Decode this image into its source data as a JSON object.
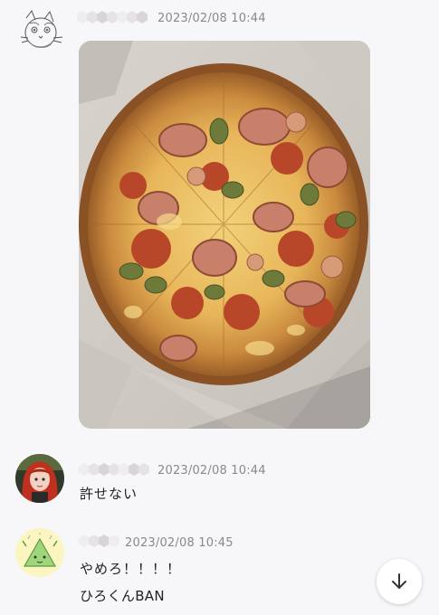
{
  "messages": [
    {
      "time": "2023/02/08 10:44",
      "avatar_icon": "cat-sketch-avatar",
      "attachment": "pizza-photo"
    },
    {
      "time": "2023/02/08 10:44",
      "avatar_icon": "red-hair-character-avatar",
      "text": "許せない"
    },
    {
      "time": "2023/02/08 10:45",
      "avatar_icon": "green-triangle-character-avatar",
      "lines": [
        "やめろ！！！！",
        "ひろくんBAN"
      ]
    }
  ],
  "scroll_button": {
    "icon": "arrow-down-icon"
  },
  "colors": {
    "background": "#f7f6f8",
    "timestamp": "#8b8790",
    "text": "#222222"
  }
}
